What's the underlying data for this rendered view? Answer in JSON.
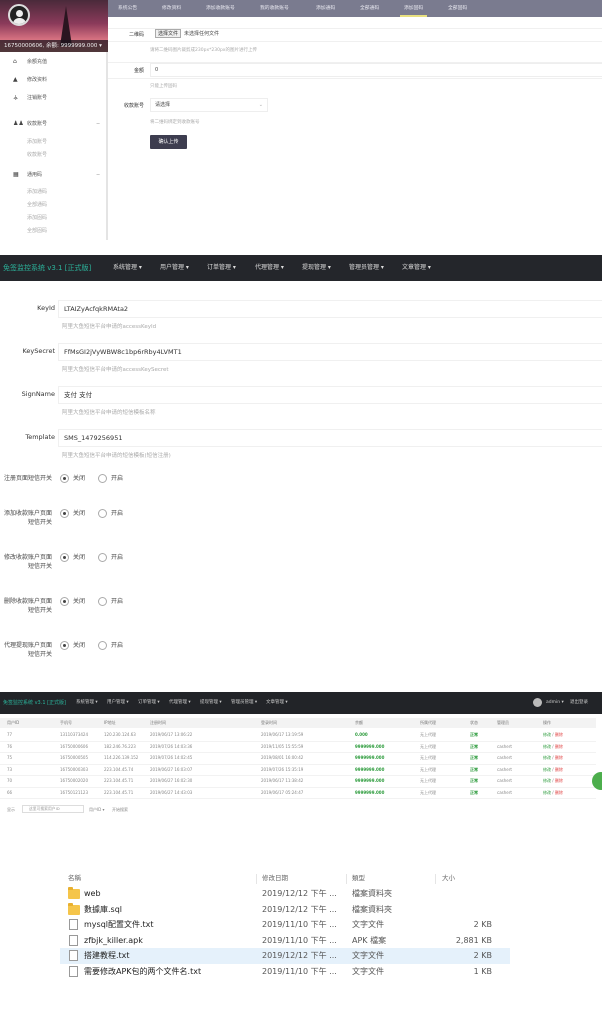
{
  "panel1": {
    "user_bar": "16750000606, 余额: 9999999.000",
    "sidebar": {
      "items": [
        {
          "icon": "home-icon",
          "glyph": "⌂",
          "label": "余额充值"
        },
        {
          "icon": "user-icon",
          "glyph": "👤",
          "label": "修改资料"
        },
        {
          "icon": "flow-icon",
          "glyph": "⚶",
          "label": "注销账号"
        }
      ],
      "groups": [
        {
          "icon": "users-icon",
          "glyph": "👥",
          "label": "收款账号",
          "toggle": "−",
          "subs": [
            "添加账号",
            "收款账号"
          ]
        },
        {
          "icon": "qrcode-icon",
          "glyph": "▦",
          "label": "通用码",
          "toggle": "−",
          "subs": [
            "添加通码",
            "全部通码",
            "添加固码",
            "全部固码"
          ]
        }
      ]
    },
    "tabs": [
      "系统公告",
      "修改资料",
      "添加收款账号",
      "我的收款账号",
      "添加通码",
      "全部通码",
      "添加固码",
      "全部固码"
    ],
    "active_tab": "添加固码",
    "form": {
      "qrcode_label": "二维码",
      "file_button": "选择文件",
      "file_status": "未选择任何文件",
      "qrcode_help": "请将二维码图片裁剪成230px*230px的图片进行上传",
      "amount_label": "金额",
      "amount_value": "0",
      "amount_help": "只能上传固码",
      "account_label": "收款账号",
      "account_placeholder": "请选择",
      "account_help": "将二维码绑定到收款账号",
      "submit": "确认上传"
    }
  },
  "panel2": {
    "brand": "免签监控系统 v3.1 [正式版]",
    "menus": [
      "系统管理 ▾",
      "用户管理 ▾",
      "订单管理 ▾",
      "代理管理 ▾",
      "提现管理 ▾",
      "管理员管理 ▾",
      "文章管理 ▾"
    ],
    "fields": [
      {
        "label": "KeyId",
        "value": "LTAIZyAcfqkRMAta2",
        "help": "阿里大鱼短信平台申请的accessKeyId"
      },
      {
        "label": "KeySecret",
        "value": "FfMsGI2jVyWBW8c1bp6rRby4LVMT1",
        "help": "阿里大鱼短信平台申请的accessKeySecret"
      },
      {
        "label": "SignName",
        "value": "支付 支付",
        "help": "阿里大鱼短信平台申请的短信模板名称"
      },
      {
        "label": "Template",
        "value": "SMS_1479256951",
        "help": "阿里大鱼短信平台申请的短信模板(短信注册)"
      }
    ],
    "switches": [
      {
        "label": "注册页面短信开关",
        "off": "关闭",
        "on": "开启",
        "selected": "off"
      },
      {
        "label": "添加收款账户页面短信开关",
        "off": "关闭",
        "on": "开启",
        "selected": "off"
      },
      {
        "label": "修改收款账户页面短信开关",
        "off": "关闭",
        "on": "开启",
        "selected": "off"
      },
      {
        "label": "删除收款账户页面短信开关",
        "off": "关闭",
        "on": "开启",
        "selected": "off"
      },
      {
        "label": "代理提现账户页面短信开关",
        "off": "关闭",
        "on": "开启",
        "selected": "off"
      }
    ]
  },
  "panel3": {
    "brand": "免签监控系统 v3.1 [正式版]",
    "menus": [
      "系统管理 ▾",
      "用户管理 ▾",
      "订单管理 ▾",
      "代理管理 ▾",
      "提现管理 ▾",
      "管理员管理 ▾",
      "文章管理 ▾"
    ],
    "admin": "admin ▾",
    "logout": "退出登录",
    "columns": [
      "用户ID",
      "手机号",
      "IP地址",
      "注册时间",
      "登录时间",
      "余额",
      "所属代理",
      "状态",
      "管理员",
      "操作"
    ],
    "rows": [
      [
        "77",
        "13110373424",
        "120.230.124.63",
        "2019/06/17 13:06:22",
        "2019/06/17 13:19:59",
        "0.000",
        "无上代理",
        "正常",
        "",
        "修改 / 删除"
      ],
      [
        "76",
        "16750000606",
        "182.246.76.223",
        "2019/07/26 14:03:36",
        "2019/11/05 15:55:59",
        "9999999.000",
        "无上代理",
        "正常",
        "cashert",
        "修改 / 删除"
      ],
      [
        "75",
        "16750000505",
        "114.226.139.152",
        "2019/07/26 14:02:45",
        "2019/08/01 16:00:42",
        "9999999.000",
        "无上代理",
        "正常",
        "cashert",
        "修改 / 删除"
      ],
      [
        "73",
        "16750000303",
        "223.104.45.74",
        "2019/06/27 16:03:07",
        "2019/07/26 15:35:19",
        "9999999.000",
        "无上代理",
        "正常",
        "cashert",
        "修改 / 删除"
      ],
      [
        "70",
        "16750002020",
        "223.104.45.71",
        "2019/06/27 16:02:30",
        "2019/06/17 11:38:42",
        "9999999.000",
        "无上代理",
        "正常",
        "cashert",
        "修改 / 删除"
      ],
      [
        "66",
        "16750121123",
        "223.104.45.71",
        "2019/06/27 14:43:03",
        "2019/06/17 05:24:47",
        "9999999.000",
        "无上代理",
        "正常",
        "cashert",
        "修改 / 删除"
      ]
    ],
    "footer": {
      "label": "显示",
      "search_placeholder": "这里可搜索用户ID",
      "filter": "用户ID ▾",
      "search_button": "开始搜索"
    }
  },
  "panel4": {
    "columns": [
      "名稱",
      "修改日期",
      "類型",
      "大小"
    ],
    "files": [
      {
        "icon": "folder",
        "name": "web",
        "date": "2019/12/12 下午 ...",
        "type": "檔案資料夾",
        "size": ""
      },
      {
        "icon": "folder",
        "name": "數據庫.sql",
        "date": "2019/12/12 下午 ...",
        "type": "檔案資料夾",
        "size": ""
      },
      {
        "icon": "file",
        "name": "mysql配置文件.txt",
        "date": "2019/11/10 下午 ...",
        "type": "文字文件",
        "size": "2 KB"
      },
      {
        "icon": "file",
        "name": "zfbjk_killer.apk",
        "date": "2019/11/10 下午 ...",
        "type": "APK 檔案",
        "size": "2,881 KB"
      },
      {
        "icon": "file",
        "name": "搭建教程.txt",
        "date": "2019/12/12 下午 ...",
        "type": "文字文件",
        "size": "2 KB",
        "selected": true
      },
      {
        "icon": "file",
        "name": "需要修改APK包的两个文件名.txt",
        "date": "2019/11/10 下午 ...",
        "type": "文字文件",
        "size": "1 KB"
      }
    ]
  },
  "colors": {
    "brand_green": "#2bb39b",
    "nav_dark": "#24262b",
    "tab_bar": "#7a7b8f",
    "submit": "#3d3d4f",
    "balance_green": "#2a9a3a",
    "delete_red": "#e04040",
    "selected_row": "#e5f1fb"
  }
}
